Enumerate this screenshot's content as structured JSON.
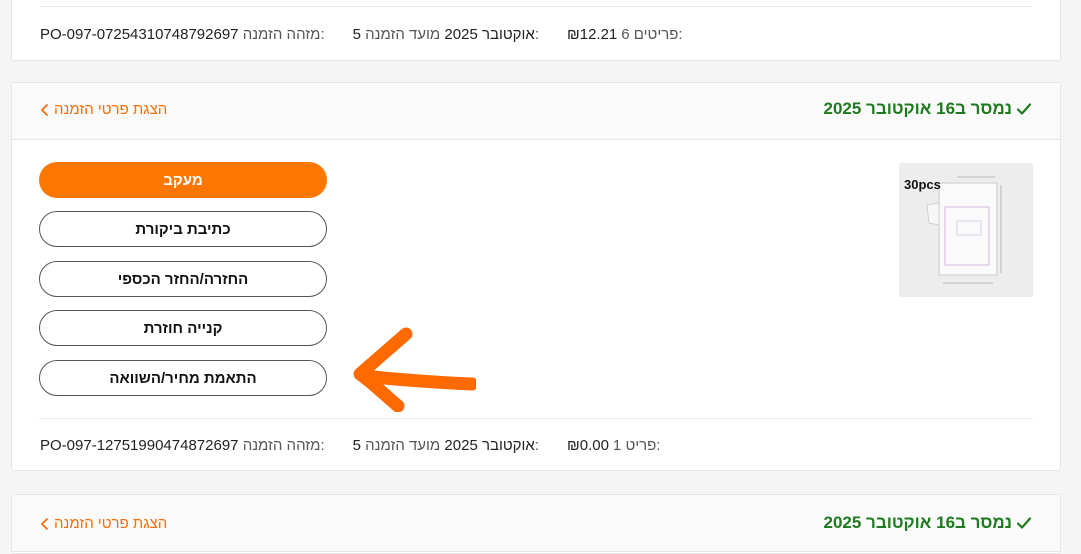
{
  "order_top": {
    "count_label": "6 פריטים:",
    "total": "₪12.21",
    "date_label": "מועד הזמנה:",
    "date_value": "5 אוקטובר 2025",
    "id_label": "מזהה הזמנה:",
    "id_value": "PO-097-07254310748792697"
  },
  "order_main": {
    "status": "נמסר ב16 אוקטובר 2025",
    "details_link": "הצגת פרטי הזמנה",
    "thumb_text": "30pcs",
    "buttons": {
      "track": "מעקב",
      "review": "כתיבת ביקורת",
      "return": "החזרה/החזר הכספי",
      "rebuy": "קנייה חוזרת",
      "price_match": "התאמת מחיר/השוואה"
    },
    "footer": {
      "count_label": "1 פריט:",
      "total": "₪0.00",
      "date_label": "מועד הזמנה:",
      "date_value": "5 אוקטובר 2025",
      "id_label": "מזהה הזמנה:",
      "id_value": "PO-097-12751990474872697"
    }
  },
  "order_bottom": {
    "status": "נמסר ב16 אוקטובר 2025",
    "details_link": "הצגת פרטי הזמנה"
  },
  "colors": {
    "accent": "#fb7701",
    "delivered": "#1f7a1f",
    "annotation_arrow": "#ff6a00"
  }
}
